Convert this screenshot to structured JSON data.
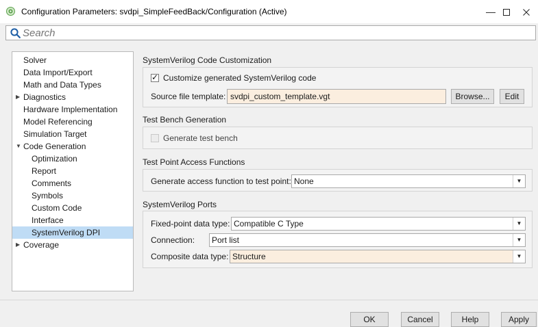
{
  "window": {
    "title": "Configuration Parameters: svdpi_SimpleFeedBack/Configuration (Active)",
    "minimize": "—",
    "maximize": "☐",
    "close": "✕"
  },
  "search": {
    "placeholder": "Search"
  },
  "tree": {
    "items": [
      {
        "label": "Solver"
      },
      {
        "label": "Data Import/Export"
      },
      {
        "label": "Math and Data Types"
      },
      {
        "label": "Diagnostics",
        "arrow": "▶"
      },
      {
        "label": "Hardware Implementation"
      },
      {
        "label": "Model Referencing"
      },
      {
        "label": "Simulation Target"
      },
      {
        "label": "Code Generation",
        "arrow": "▼"
      },
      {
        "label": "Optimization"
      },
      {
        "label": "Report"
      },
      {
        "label": "Comments"
      },
      {
        "label": "Symbols"
      },
      {
        "label": "Custom Code"
      },
      {
        "label": "Interface"
      },
      {
        "label": "SystemVerilog DPI",
        "selected": true
      },
      {
        "label": "Coverage",
        "arrow": "▶"
      }
    ]
  },
  "sections": {
    "customization": {
      "title": "SystemVerilog Code Customization",
      "customize_label": "Customize generated SystemVerilog code",
      "customize_checked": true,
      "check_mark": "✓",
      "template_label": "Source file template:",
      "template_value": "svdpi_custom_template.vgt",
      "browse_label": "Browse...",
      "edit_label": "Edit"
    },
    "testbench": {
      "title": "Test Bench Generation",
      "generate_label": "Generate test bench",
      "generate_checked": false
    },
    "testpoint": {
      "title": "Test Point Access Functions",
      "access_label": "Generate access function to test point:",
      "access_value": "None"
    },
    "ports": {
      "title": "SystemVerilog Ports",
      "fixed_label": "Fixed-point data type:",
      "fixed_value": "Compatible C Type",
      "connection_label": "Connection:",
      "connection_value": "Port list",
      "composite_label": "Composite data type:",
      "composite_value": "Structure"
    }
  },
  "dropdown_arrow": "▼",
  "footer": {
    "ok": "OK",
    "cancel": "Cancel",
    "help": "Help",
    "apply": "Apply"
  },
  "colors": {
    "selected_tree": "#bfdcf5",
    "modified_field": "#fbeedf",
    "app_icon": "#5aa04a"
  }
}
